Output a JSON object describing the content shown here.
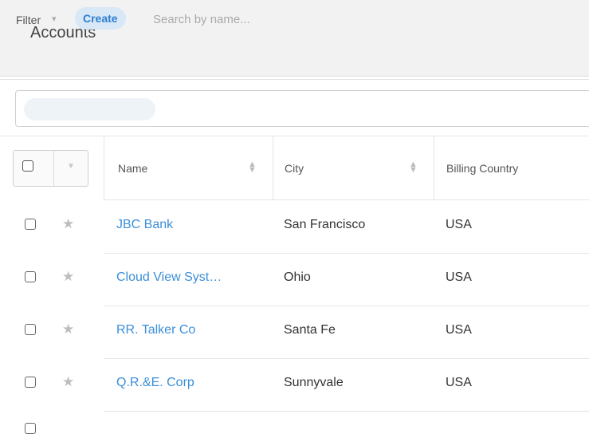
{
  "header": {
    "title": "Accounts"
  },
  "filter_bar": {
    "filter_label": "Filter",
    "filter_caret": "▾",
    "create_label": "Create",
    "search_placeholder": "Search by name..."
  },
  "table": {
    "columns": [
      {
        "label": "Name",
        "sortable": true
      },
      {
        "label": "City",
        "sortable": true
      },
      {
        "label": "Billing Country",
        "sortable": false
      }
    ],
    "rows": [
      {
        "name": "JBC Bank",
        "city": "San Francisco",
        "country": "USA"
      },
      {
        "name": "Cloud View Syst…",
        "city": "Ohio",
        "country": "USA"
      },
      {
        "name": "RR. Talker Co",
        "city": "Santa Fe",
        "country": "USA"
      },
      {
        "name": "Q.R.&E. Corp",
        "city": "Sunnyvale",
        "country": "USA"
      }
    ]
  },
  "icons": {
    "star": "★",
    "sort_up": "▲",
    "sort_down": "▼"
  },
  "colors": {
    "link": "#3b8ed8",
    "create_bg": "#d8e8f7",
    "header_bg": "#f2f2f2"
  }
}
